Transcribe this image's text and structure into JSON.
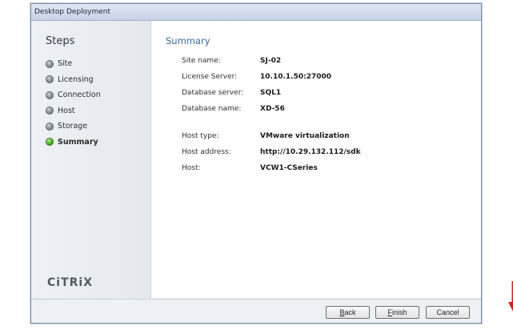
{
  "window": {
    "title": "Desktop Deployment"
  },
  "sidebar": {
    "title": "Steps",
    "steps": [
      {
        "label": "Site",
        "active": false
      },
      {
        "label": "Licensing",
        "active": false
      },
      {
        "label": "Connection",
        "active": false
      },
      {
        "label": "Host",
        "active": false
      },
      {
        "label": "Storage",
        "active": false
      },
      {
        "label": "Summary",
        "active": true
      }
    ],
    "logo_text": "CiTRiX",
    "logo_icon": "citrix-logo"
  },
  "main": {
    "title": "Summary",
    "rows": [
      {
        "label": "Site name:",
        "value": "SJ-02"
      },
      {
        "label": "License Server:",
        "value": "10.10.1.50:27000"
      },
      {
        "label": "Database server:",
        "value": "SQL1"
      },
      {
        "label": "Database name:",
        "value": "XD-56"
      },
      {
        "label": "Host type:",
        "value": "VMware virtualization"
      },
      {
        "label": "Host address:",
        "value": "http://10.29.132.112/sdk"
      },
      {
        "label": "Host:",
        "value": "VCW1-CSeries"
      }
    ]
  },
  "footer": {
    "back_mnemonic": "B",
    "back_rest": "ack",
    "finish_mnemonic": "F",
    "finish_rest": "inish",
    "cancel_label": "Cancel"
  },
  "annotation": {
    "arrow_color": "#e01b1b",
    "arrow_icon": "arrow-down-icon"
  }
}
